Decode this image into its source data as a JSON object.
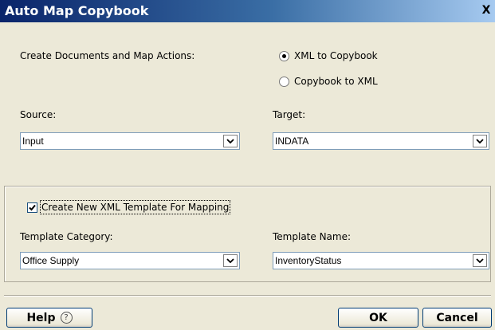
{
  "window": {
    "title": "Auto Map Copybook",
    "close_glyph": "X"
  },
  "mode": {
    "label": "Create Documents and Map Actions:",
    "options": [
      {
        "label": "XML to Copybook",
        "selected": true
      },
      {
        "label": "Copybook to XML",
        "selected": false
      }
    ]
  },
  "source": {
    "label": "Source:",
    "value": "Input"
  },
  "target": {
    "label": "Target:",
    "value": "INDATA"
  },
  "template": {
    "checkbox_label": "Create New XML Template For Mapping",
    "checked": true,
    "category_label": "Template Category:",
    "category_value": "Office Supply",
    "name_label": "Template Name:",
    "name_value": "InventoryStatus"
  },
  "buttons": {
    "help": "Help",
    "help_glyph": "?",
    "ok": "OK",
    "cancel": "Cancel"
  },
  "icons": {
    "dropdown": "chevron-down-icon",
    "help": "question-circle-icon",
    "check": "checkmark-icon"
  }
}
